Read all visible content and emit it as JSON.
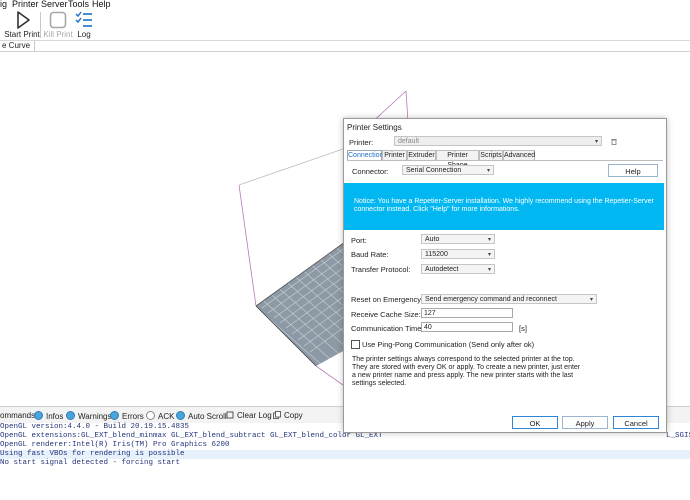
{
  "menu": {
    "items": [
      "ig",
      "Printer",
      "Server",
      "Tools",
      "Help"
    ]
  },
  "toolbar": {
    "start_print": "Start Print",
    "kill_print": "Kill Print",
    "log": "Log"
  },
  "tab_strip": {
    "active_tab": "e Curve"
  },
  "log_panel": {
    "toolbar": {
      "commands": "ommands",
      "infos": "Infos",
      "warnings": "Warnings",
      "errors": "Errors",
      "ack": "ACK",
      "auto_scroll": "Auto Scroll",
      "clear_log": "Clear Log",
      "copy": "Copy"
    },
    "lines": [
      "OpenGL version:4.4.0 - Build 20.19.15.4835",
      "OpenGL extensions:GL_EXT_blend_minmax GL_EXT_blend_subtract GL_EXT_blend_color GL_EXT",
      "OpenGL renderer:Intel(R) Iris(TM) Pro Graphics 6200",
      "Using fast VBOs for rendering is possible",
      "No start signal detected - forcing start"
    ],
    "line_overflow_right": "L_SGIS"
  },
  "dialog": {
    "title": "Printer Settings",
    "printer_label": "Printer:",
    "printer_value": "default",
    "tabs": [
      "Connection",
      "Printer",
      "Extruder",
      "Printer Shape",
      "Scripts",
      "Advanced"
    ],
    "active_tab": "Connection",
    "connector_label": "Connector:",
    "connector_value": "Serial Connection",
    "help_button": "Help",
    "notice": "Notice: You have a Repetier-Server installation. We highly recommend using the Repetier-Server connector instead. Click \"Help\" for more informations.",
    "port_label": "Port:",
    "port_value": "Auto",
    "baud_label": "Baud Rate:",
    "baud_value": "115200",
    "protocol_label": "Transfer Protocol:",
    "protocol_value": "Autodetect",
    "reset_label": "Reset on Emergency",
    "reset_value": "Send emergency command and reconnect",
    "cache_label": "Receive Cache Size:",
    "cache_value": "127",
    "timeout_label": "Communication Timeout:",
    "timeout_value": "40",
    "timeout_unit": "[s]",
    "pingpong_label": "Use Ping-Pong Communication (Send only after ok)",
    "info": "The printer settings always correspond to the selected printer at the top. They are stored with every OK or apply. To create a new printer, just enter a new printer name and press apply. The new printer starts with the last settings selected.",
    "ok_button": "OK",
    "apply_button": "Apply",
    "cancel_button": "Cancel"
  },
  "colors": {
    "notice_bg": "#00b7f1",
    "accent": "#1d6fc5",
    "bed": "#8d9aa5"
  }
}
